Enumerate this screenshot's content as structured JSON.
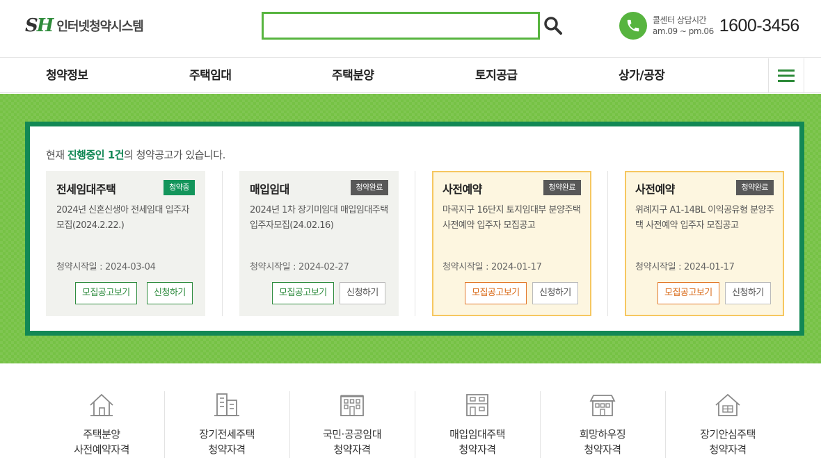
{
  "header": {
    "logo_mark_s": "S",
    "logo_mark_h": "H",
    "logo_text": "인터넷청약시스템",
    "search_placeholder": "",
    "call_label": "콜센터 상담시간",
    "call_hours": "am.09 ~ pm.06",
    "call_number": "1600-3456"
  },
  "nav": {
    "items": [
      "청약정보",
      "주택임대",
      "주택분양",
      "토지공급",
      "상가/공장"
    ],
    "menu_icon": "hamburger-icon"
  },
  "notice": {
    "prefix": "현재 ",
    "highlight": "진행중인 1건",
    "suffix": "의 청약공고가 있습니다."
  },
  "cards": [
    {
      "title": "전세임대주택",
      "badge": "청약중",
      "description": "2024년 신혼신생아 전세임대 입주자모집(2024.2.22.)",
      "date": "청약시작일 : 2024-03-04",
      "notice_button": "모집공고보기",
      "apply_button": "신청하기"
    },
    {
      "title": "매입임대",
      "badge": "청약완료",
      "description": "2024년 1차 장기미임대 매입임대주택 입주자모집(24.02.16)",
      "date": "청약시작일 : 2024-02-27",
      "notice_button": "모집공고보기",
      "apply_button": "신청하기"
    },
    {
      "title": "사전예약",
      "badge": "청약완료",
      "description": "마곡지구 16단지 토지임대부 분양주택 사전예약 입주자 모집공고",
      "date": "청약시작일 : 2024-01-17",
      "notice_button": "모집공고보기",
      "apply_button": "신청하기"
    },
    {
      "title": "사전예약",
      "badge": "청약완료",
      "description": "위례지구 A1-14BL 이익공유형 분양주택 사전예약 입주자 모집공고",
      "date": "청약시작일 : 2024-01-17",
      "notice_button": "모집공고보기",
      "apply_button": "신청하기"
    }
  ],
  "quick_links": [
    {
      "line1": "주택분양",
      "line2": "사전예약자격",
      "icon": "house-icon"
    },
    {
      "line1": "장기전세주택",
      "line2": "청약자격",
      "icon": "building-icon"
    },
    {
      "line1": "국민·공공임대",
      "line2": "청약자격",
      "icon": "apartment-icon"
    },
    {
      "line1": "매입임대주택",
      "line2": "청약자격",
      "icon": "multiplex-icon"
    },
    {
      "line1": "희망하우징",
      "line2": "청약자격",
      "icon": "dormitory-icon"
    },
    {
      "line1": "장기안심주택",
      "line2": "청약자격",
      "icon": "safe-house-icon"
    }
  ],
  "colors": {
    "brand_green": "#57b43f",
    "panel_border": "#128855",
    "active_badge": "#13955b",
    "done_badge": "#585858",
    "highlight_card_border": "#f6c760"
  }
}
